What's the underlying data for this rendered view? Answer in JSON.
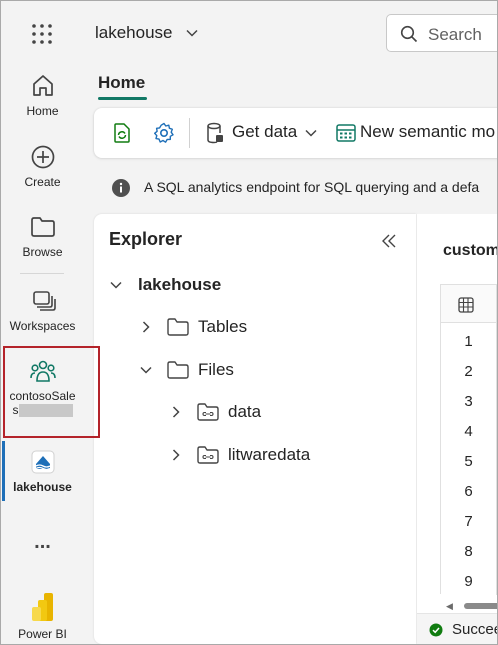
{
  "rail": {
    "items": [
      {
        "label": "Home",
        "icon": "home-icon"
      },
      {
        "label": "Create",
        "icon": "plus-circle-icon"
      },
      {
        "label": "Browse",
        "icon": "folder-icon"
      },
      {
        "label": "Workspaces",
        "icon": "workspaces-icon"
      },
      {
        "label_line1": "contosoSale",
        "label_line2": "s",
        "icon": "people-icon"
      },
      {
        "label": "lakehouse",
        "icon": "lakehouse-icon"
      },
      {
        "label": "Power BI",
        "icon": "powerbi-icon"
      }
    ],
    "more": "..."
  },
  "topbar": {
    "workspace_title": "lakehouse",
    "search_placeholder": "Search"
  },
  "ribbon": {
    "tab_label": "Home",
    "get_data": "Get data",
    "new_semantic_model": "New semantic mo"
  },
  "info": {
    "message": "A SQL analytics endpoint for SQL querying and a defa"
  },
  "explorer": {
    "title": "Explorer",
    "root": "lakehouse",
    "tables": "Tables",
    "files": "Files",
    "subfolders": [
      "data",
      "litwaredata"
    ]
  },
  "preview": {
    "tab_label": "custom",
    "row_numbers": [
      "1",
      "2",
      "3",
      "4",
      "5",
      "6",
      "7",
      "8",
      "9"
    ]
  },
  "status": {
    "text": "Succee"
  },
  "colors": {
    "accent_teal": "#117865",
    "highlight_red": "#b4232a",
    "success_green": "#107c10"
  }
}
